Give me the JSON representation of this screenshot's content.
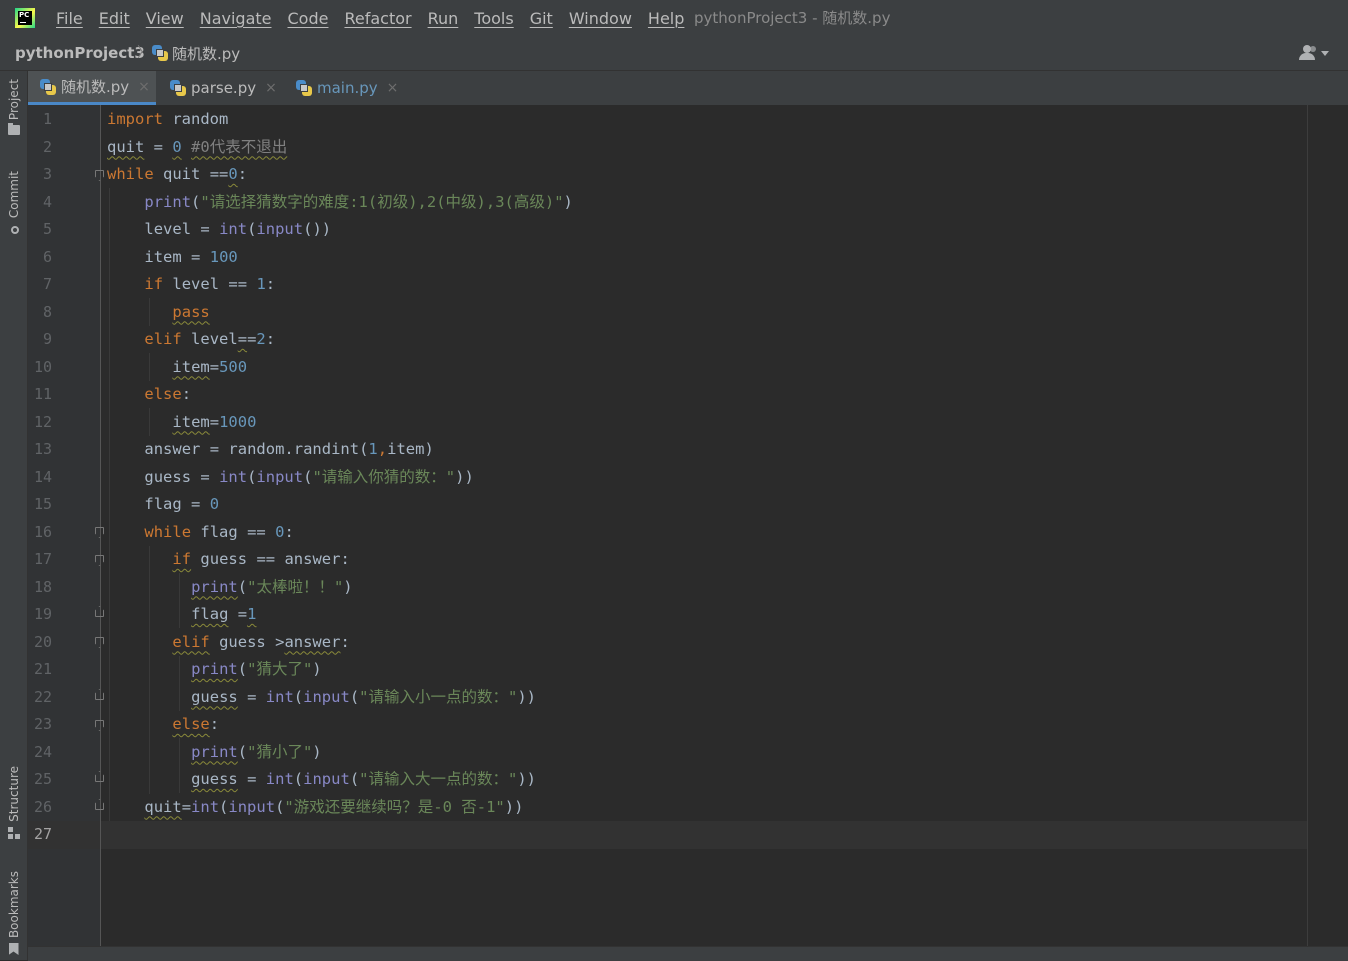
{
  "menubar": {
    "items": [
      "File",
      "Edit",
      "View",
      "Navigate",
      "Code",
      "Refactor",
      "Run",
      "Tools",
      "Git",
      "Window",
      "Help"
    ],
    "window_title": "pythonProject3 - 随机数.py"
  },
  "navbar": {
    "project": "pythonProject3",
    "separator": "〉",
    "file": "随机数.py"
  },
  "sidebar": {
    "project_label": "Project",
    "commit_label": "Commit",
    "structure_label": "Structure",
    "bookmarks_label": "Bookmarks"
  },
  "tabs": [
    {
      "label": "随机数.py",
      "close": "×",
      "active": true
    },
    {
      "label": "parse.py",
      "close": "×",
      "active": false
    },
    {
      "label": "main.py",
      "close": "×",
      "active": false
    }
  ],
  "editor": {
    "current_line": 27,
    "line_numbers": [
      "1",
      "2",
      "3",
      "4",
      "5",
      "6",
      "7",
      "8",
      "9",
      "10",
      "11",
      "12",
      "13",
      "14",
      "15",
      "16",
      "17",
      "18",
      "19",
      "20",
      "21",
      "22",
      "23",
      "24",
      "25",
      "26",
      "27"
    ],
    "lines": [
      "import random",
      "quit = 0 #0代表不退出",
      "while quit ==0:",
      "    print(\"请选择猜数字的难度:1(初级),2(中级),3(高级)\")",
      "    level = int(input())",
      "    item = 100",
      "    if level == 1:",
      "       pass",
      "    elif level==2:",
      "       item=500",
      "    else:",
      "       item=1000",
      "    answer = random.randint(1,item)",
      "    guess = int(input(\"请输入你猜的数：\"))",
      "    flag = 0",
      "    while flag == 0:",
      "       if guess == answer:",
      "         print(\"太棒啦！！\")",
      "         flag =1",
      "       elif guess >answer:",
      "         print(\"猜大了\")",
      "         guess = int(input(\"请输入小一点的数：\"))",
      "       else:",
      "         print(\"猜小了\")",
      "         guess = int(input(\"请输入大一点的数：\"))",
      "    quit=int(input(\"游戏还要继续吗？是-0 否-1\"))",
      ""
    ]
  },
  "colors": {
    "keyword": "#cc7832",
    "number": "#6897bb",
    "string": "#6a8759",
    "builtin": "#8888c6",
    "comment": "#808080",
    "identifier": "#a9b7c6",
    "background": "#2b2b2b",
    "active_tab_accent": "#4a88c7"
  }
}
